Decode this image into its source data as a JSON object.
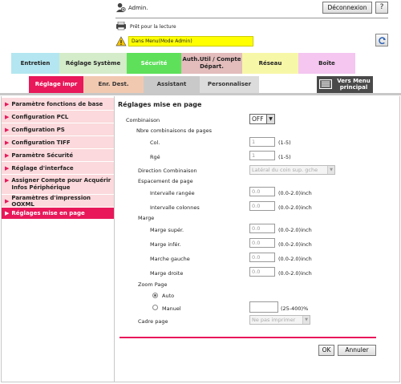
{
  "header": {
    "user": "Admin.",
    "logout_label": "Déconnexion",
    "help_label": "?",
    "status_ready": "Prêt pour la lecture",
    "status_mode": "Dans Menu(Mode Admin)",
    "refresh_icon": "refresh-icon"
  },
  "main_tabs": [
    {
      "label": "Entretien"
    },
    {
      "label": "Réglage Système"
    },
    {
      "label": "Sécurité"
    },
    {
      "label": "Auth.Util / Compte Départ."
    },
    {
      "label": "Réseau"
    },
    {
      "label": "Boîte"
    }
  ],
  "sub_tabs": [
    {
      "label": "Réglage impr"
    },
    {
      "label": "Enr. Dest."
    },
    {
      "label": "Assistant"
    },
    {
      "label": "Personnaliser"
    }
  ],
  "vers_menu_label": "Vers Menu principal",
  "nav": [
    {
      "label": "Paramètre fonctions de base"
    },
    {
      "label": "Configuration PCL"
    },
    {
      "label": "Configuration PS"
    },
    {
      "label": "Configuration TIFF"
    },
    {
      "label": "Paramètre Sécurité"
    },
    {
      "label": "Réglage d'interface"
    },
    {
      "label": "Assigner Compte pour Acquérir Infos Périphérique"
    },
    {
      "label": "Paramètres d'impression OOXML"
    },
    {
      "label": "Réglages mise en page"
    }
  ],
  "form": {
    "title": "Réglages mise en page",
    "combinaison_label": "Combinaison",
    "combinaison_value": "OFF",
    "nbre_label": "Nbre combinaisons de pages",
    "col_label": "Col.",
    "col_value": "1",
    "col_unit": "(1-5)",
    "rge_label": "Rgé",
    "rge_value": "1",
    "rge_unit": "(1-5)",
    "direction_label": "Direction Combinaison",
    "direction_value": "Latéral du coin sup. gche",
    "espacement_label": "Espacement de page",
    "int_rangee_label": "Intervalle rangée",
    "int_rangee_value": "0.0",
    "int_colonnes_label": "Intervalle colonnes",
    "int_colonnes_value": "0.0",
    "range_unit": "(0.0-2.0)inch",
    "marge_label": "Marge",
    "marge_sup_label": "Marge supér.",
    "marge_sup_value": "0.0",
    "marge_inf_label": "Marge infér.",
    "marge_inf_value": "0.0",
    "marche_gauche_label": "Marche gauche",
    "marche_gauche_value": "0.0",
    "marge_droite_label": "Marge droite",
    "marge_droite_value": "0.0",
    "zoom_label": "Zoom Page",
    "zoom_auto_label": "Auto",
    "zoom_manuel_label": "Manuel",
    "zoom_value": "",
    "zoom_unit": "(25-400)%",
    "cadre_label": "Cadre page",
    "cadre_value": "Ne pas imprimer",
    "ok_label": "OK",
    "cancel_label": "Annuler"
  },
  "colors": {
    "accent": "#e8185a",
    "status_yellow": "#ffff00",
    "nav_bg": "#fbd9dc"
  }
}
